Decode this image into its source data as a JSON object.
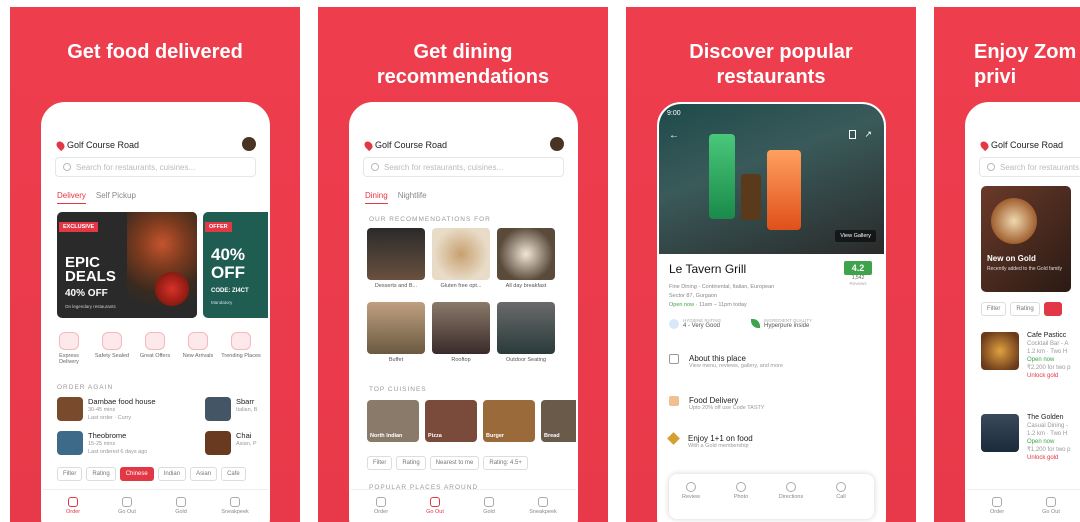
{
  "panels": [
    {
      "title": "Get food delivered"
    },
    {
      "title": "Get dining recommendations"
    },
    {
      "title": "Discover popular restaurants"
    },
    {
      "title": "Enjoy Zom privi"
    }
  ],
  "p1": {
    "location": "Golf Course Road",
    "search_placeholder": "Search for restaurants, cuisines...",
    "tabs": [
      "Delivery",
      "Self Pickup"
    ],
    "banner1": {
      "tag": "EXCLUSIVE",
      "line1": "EPIC",
      "line2": "DEALS",
      "pct": "40% OFF",
      "sub": "On legendary restaurants"
    },
    "banner2": {
      "tag": "OFFER",
      "big1": "40%",
      "big2": "OFF",
      "code": "CODE: ZI4CT",
      "sub": "Mandatory"
    },
    "categories": [
      "Express Delivery",
      "Safety Sealed",
      "Great Offers",
      "New Arrivals",
      "Trending Places"
    ],
    "order_again": "ORDER AGAIN",
    "orders": [
      {
        "name": "Dambae food house",
        "time": "30-45 mins",
        "last": "Last order · Curry"
      },
      {
        "name": "Theobrome",
        "time": "15-25 mins",
        "last": "Last ordered 6 days ago"
      }
    ],
    "orders_right": [
      {
        "name": "Sbarr",
        "sub": "Italian, B"
      },
      {
        "name": "Chai",
        "sub": "Asian, P"
      }
    ],
    "chips": [
      "Filter",
      "Rating",
      "Chinese",
      "Indian",
      "Asian",
      "Cafe"
    ],
    "nav": [
      "Order",
      "Go Out",
      "Gold",
      "Sneakpeek"
    ]
  },
  "p2": {
    "location": "Golf Course Road",
    "search_placeholder": "Search for restaurants, cuisines...",
    "tabs": [
      "Dining",
      "Nightlife"
    ],
    "rec_header": "OUR RECOMMENDATIONS FOR",
    "recs": [
      "Desserts and B...",
      "Gluten free opt...",
      "All day breakfast",
      "Buffet",
      "Rooftop",
      "Outdoor Seating"
    ],
    "top_cuisines": "TOP CUISINES",
    "cuisines": [
      "North Indian",
      "Pizza",
      "Burger",
      "Bread"
    ],
    "chips": [
      "Filter",
      "Rating",
      "Nearest to me",
      "Rating: 4.5+"
    ],
    "popular": "POPULAR PLACES AROUND",
    "nav": [
      "Order",
      "Go Out",
      "Gold",
      "Sneakpeek"
    ]
  },
  "p3": {
    "status_time": "9:00",
    "view_gallery": "View Gallery",
    "name": "Le Tavern Grill",
    "rating": "4.2",
    "reviews": "1,542",
    "reviews_label": "Reviews",
    "cuisine": "Fine Dining - Continental, Italian, European",
    "address": "Sector 87, Gurgaon",
    "open": "Open now",
    "timing": "11am – 11pm today",
    "hygiene_label": "HYGIENE RATING",
    "hygiene": "4 - Very Good",
    "ingredient_label": "INGREDIENT QUALITY",
    "ingredient": "Hyperpure inside",
    "rows": [
      {
        "title": "About this place",
        "sub": "View menu, reviews, gallery, and more"
      },
      {
        "title": "Food Delivery",
        "sub": "Upto 20% off use Code TASTY"
      },
      {
        "title": "Enjoy 1+1 on food",
        "sub": "With a Gold membership"
      }
    ],
    "actions": [
      "Review",
      "Photo",
      "Directions",
      "Call"
    ]
  },
  "p4": {
    "location": "Golf Course Road",
    "search_placeholder": "Search for restaurants",
    "banner": "New on Gold",
    "banner_sub": "Recently added to the Gold family",
    "chips": [
      "Filter",
      "Rating"
    ],
    "places": [
      {
        "name": "Cafe Pasticc",
        "type": "Cocktail Bar - A",
        "dist": "1.2 km",
        "time": "Two H",
        "open": "Open now",
        "price": "₹2,200 for two p",
        "unlock": "Unlock gold"
      },
      {
        "name": "The Golden",
        "type": "Casual Dining -",
        "dist": "1.2 km",
        "time": "Two H",
        "open": "Open now",
        "price": "₹1,200 for two p",
        "unlock": "Unlock gold"
      }
    ],
    "nav": [
      "Order",
      "Go Out"
    ]
  }
}
